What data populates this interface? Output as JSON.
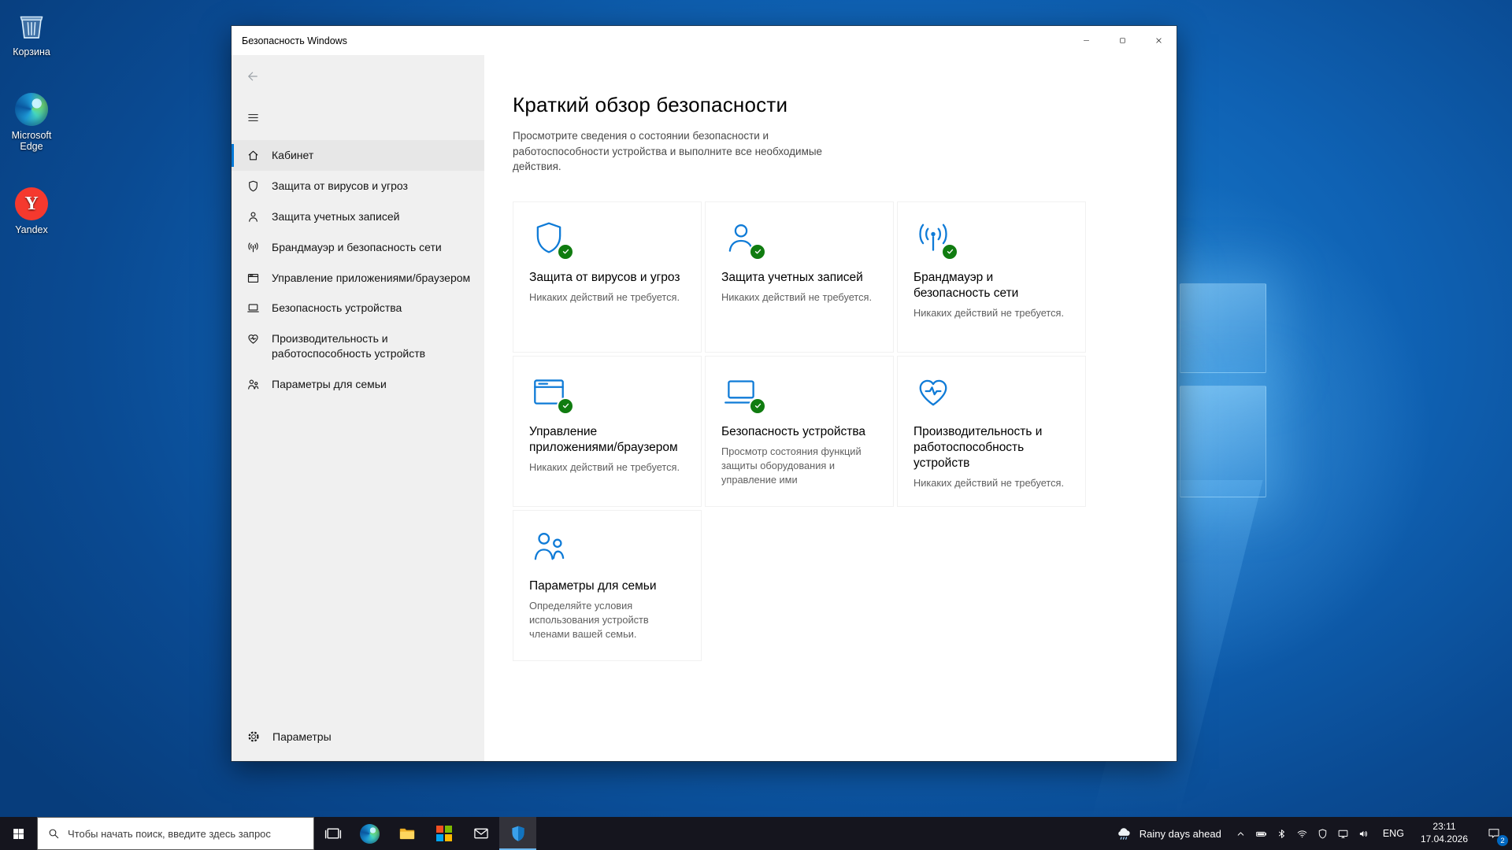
{
  "colors": {
    "accent": "#0078d7",
    "success": "#107c10",
    "tile_icon": "#0f7bd7"
  },
  "desktop": {
    "icons": [
      {
        "name": "recycle-bin",
        "label": "Корзина"
      },
      {
        "name": "edge",
        "label": "Microsoft Edge"
      },
      {
        "name": "yandex",
        "label": "Yandex"
      }
    ]
  },
  "window": {
    "title": "Безопасность Windows",
    "sidebar": {
      "items": [
        {
          "icon": "home",
          "label": "Кабинет",
          "active": true
        },
        {
          "icon": "shield",
          "label": "Защита от вирусов и угроз",
          "active": false
        },
        {
          "icon": "person",
          "label": "Защита учетных записей",
          "active": false
        },
        {
          "icon": "network",
          "label": "Брандмауэр и безопасность сети",
          "active": false
        },
        {
          "icon": "apps",
          "label": "Управление приложениями/браузером",
          "active": false
        },
        {
          "icon": "device",
          "label": "Безопасность устройства",
          "active": false
        },
        {
          "icon": "health",
          "label": "Производительность и работоспособность устройств",
          "active": false
        },
        {
          "icon": "family",
          "label": "Параметры для семьи",
          "active": false
        }
      ],
      "settings_label": "Параметры"
    },
    "main": {
      "title": "Краткий обзор безопасности",
      "subtitle": "Просмотрите сведения о состоянии безопасности и работоспособности устройства и выполните все необходимые действия.",
      "tiles": [
        {
          "icon": "shield",
          "title": "Защита от вирусов и угроз",
          "status": "Никаких действий не требуется.",
          "check": true
        },
        {
          "icon": "person",
          "title": "Защита учетных записей",
          "status": "Никаких действий не требуется.",
          "check": true
        },
        {
          "icon": "network",
          "title": "Брандмауэр и безопасность сети",
          "status": "Никаких действий не требуется.",
          "check": true
        },
        {
          "icon": "apps",
          "title": "Управление приложениями/браузером",
          "status": "Никаких действий не требуется.",
          "check": true
        },
        {
          "icon": "device",
          "title": "Безопасность устройства",
          "status": "Просмотр состояния функций защиты оборудования и управление ими",
          "check": true
        },
        {
          "icon": "health",
          "title": "Производительность и работоспособность устройств",
          "status": "Никаких действий не требуется.",
          "check": false
        },
        {
          "icon": "family",
          "title": "Параметры для семьи",
          "status": "Определяйте условия использования устройств членами вашей семьи.",
          "check": false
        }
      ]
    }
  },
  "taskbar": {
    "search_placeholder": "Чтобы начать поиск, введите здесь запрос",
    "pinned": [
      {
        "name": "task-view",
        "active": false
      },
      {
        "name": "edge",
        "active": false
      },
      {
        "name": "file-explorer",
        "active": false
      },
      {
        "name": "store",
        "active": false
      },
      {
        "name": "mail",
        "active": false
      },
      {
        "name": "windows-security",
        "active": true
      }
    ],
    "weather": {
      "icon": "weather-rain",
      "label": "Rainy days ahead"
    },
    "tray_icons": [
      "chevron-up",
      "battery",
      "bluetooth",
      "wifi",
      "shield",
      "display",
      "volume"
    ],
    "language": "ENG",
    "clock": {
      "time": "23:11",
      "date": "17.04.2026"
    },
    "action_center_badge": "2"
  }
}
